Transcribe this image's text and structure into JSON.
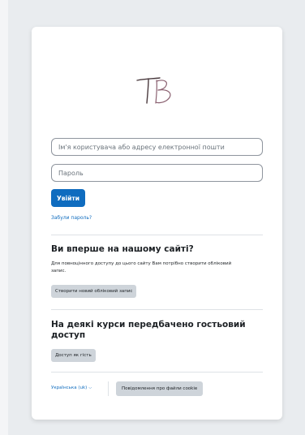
{
  "login": {
    "username_placeholder": "Ім'я користувача або адресу електронної пошти",
    "password_placeholder": "Пароль",
    "login_button": "Увійти",
    "forgot_link": "Забули пароль?"
  },
  "first_time": {
    "heading": "Ви вперше на нашому сайті?",
    "description": "Для повноцінного доступу до цього сайту Вам потрібно створити обліковий запис.",
    "signup_button": "Створити новий обліковий запис"
  },
  "guest": {
    "heading": "На деякі курси передбачено гостьовий доступ",
    "button": "Доступ як гість"
  },
  "footer": {
    "language": "Українська (uk)",
    "cookie_button": "Повідомлення про файли cookie"
  },
  "colors": {
    "primary": "#0f6cbf",
    "secondary_button": "#ced4da",
    "background": "#e9ecef"
  },
  "icons": {
    "logo": "tb-logo",
    "language_dropdown": "chevron-down-icon"
  }
}
